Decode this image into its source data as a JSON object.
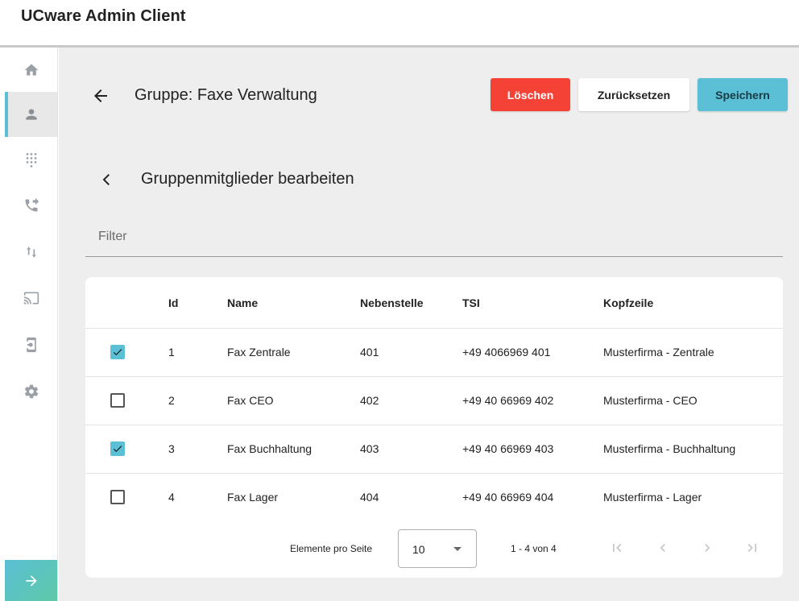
{
  "app": {
    "title": "UCware Admin Client"
  },
  "sidebar": {
    "items": [
      {
        "name": "home",
        "icon": "home-icon"
      },
      {
        "name": "users",
        "icon": "person-icon",
        "active": true
      },
      {
        "name": "dialpad",
        "icon": "dialpad-icon"
      },
      {
        "name": "call-forward",
        "icon": "phone-forward-icon"
      },
      {
        "name": "sort",
        "icon": "arrows-icon"
      },
      {
        "name": "cast",
        "icon": "cast-icon"
      },
      {
        "name": "device",
        "icon": "device-settings-icon"
      },
      {
        "name": "settings",
        "icon": "gear-icon"
      }
    ],
    "expand_icon": "arrow-right-icon"
  },
  "header": {
    "title": "Gruppe: Faxe Verwaltung",
    "delete_label": "Löschen",
    "reset_label": "Zurücksetzen",
    "save_label": "Speichern"
  },
  "section": {
    "title": "Gruppenmitglieder bearbeiten"
  },
  "filter": {
    "placeholder": "Filter",
    "value": ""
  },
  "table": {
    "columns": {
      "id": "Id",
      "name": "Name",
      "extension": "Nebenstelle",
      "tsi": "TSI",
      "header": "Kopfzeile"
    },
    "rows": [
      {
        "checked": true,
        "id": "1",
        "name": "Fax Zentrale",
        "extension": "401",
        "tsi": "+49 4066969 401",
        "header": "Musterfirma - Zentrale"
      },
      {
        "checked": false,
        "id": "2",
        "name": "Fax CEO",
        "extension": "402",
        "tsi": "+49 40 66969 402",
        "header": "Musterfirma - CEO"
      },
      {
        "checked": true,
        "id": "3",
        "name": "Fax Buchhaltung",
        "extension": "403",
        "tsi": "+49 40 66969 403",
        "header": "Musterfirma - Buchhaltung"
      },
      {
        "checked": false,
        "id": "4",
        "name": "Fax Lager",
        "extension": "404",
        "tsi": "+49 40 66969 404",
        "header": "Musterfirma - Lager"
      }
    ]
  },
  "paginator": {
    "per_page_label": "Elemente pro Seite",
    "per_page_value": "10",
    "range_label": "1 - 4 von 4"
  },
  "colors": {
    "accent": "#5bbfd6",
    "danger": "#f44336",
    "background": "#eeeeee"
  }
}
